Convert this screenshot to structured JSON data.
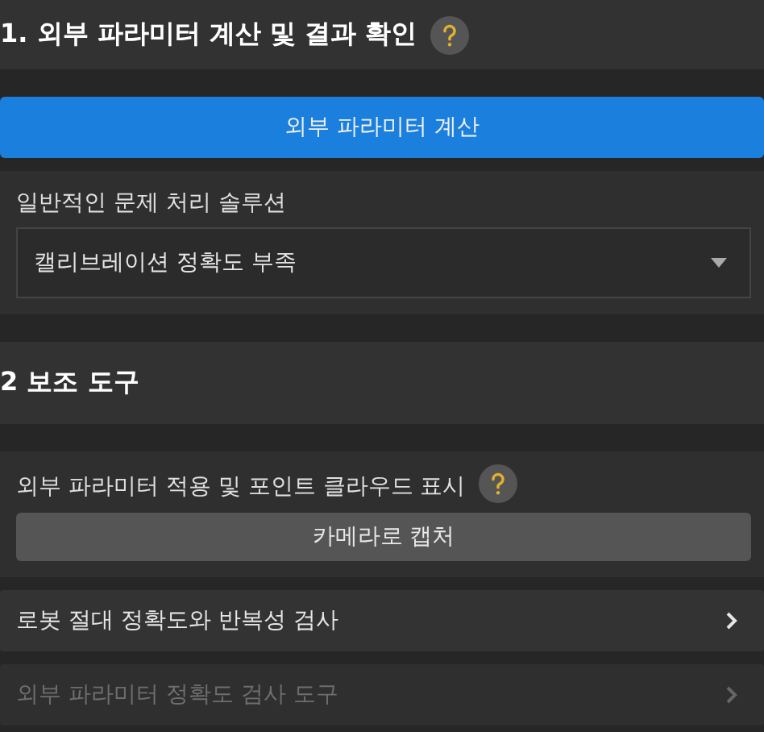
{
  "sections": [
    {
      "title": "1. 외부 파라미터 계산 및 결과 확인",
      "help": true,
      "blocks": [
        {
          "kind": "primary_button",
          "label": "외부 파라미터 계산"
        },
        {
          "kind": "dropdown_panel",
          "label": "일반적인 문제 처리 솔루션",
          "value": "캘리브레이션 정확도 부족"
        }
      ]
    },
    {
      "title": "2 보조 도구",
      "help": false,
      "blocks": [
        {
          "kind": "button_panel",
          "label": "외부 파라미터 적용 및 포인트 클라우드 표시",
          "help": true,
          "button": "카메라로 캡처"
        },
        {
          "kind": "link_row",
          "label": "로봇 절대 정확도와 반복성 검사",
          "disabled": false
        },
        {
          "kind": "link_row",
          "label": "외부 파라미터 정확도 검사 도구",
          "disabled": true
        }
      ]
    }
  ]
}
